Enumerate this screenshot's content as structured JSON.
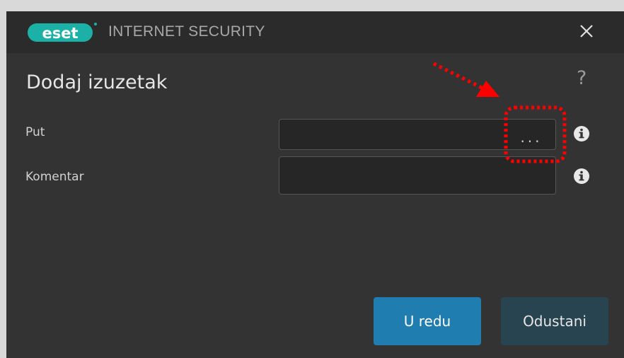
{
  "titlebar": {
    "logo_text": "eset",
    "product_name": "INTERNET SECURITY",
    "close_label": "×"
  },
  "dialog": {
    "title": "Dodaj izuzetak",
    "help_label": "?"
  },
  "form": {
    "path_label": "Put",
    "path_value": "",
    "browse_label": "...",
    "comment_label": "Komentar",
    "comment_value": ""
  },
  "buttons": {
    "ok_label": "U redu",
    "cancel_label": "Odustani"
  },
  "colors": {
    "window_bg": "#333333",
    "titlebar_bg": "#2b2b2b",
    "ok_button": "#1f7db0",
    "cancel_button": "#294451",
    "eset_teal": "#1cb1a7",
    "annotation_red": "#ff0000"
  },
  "icons": {
    "close": "close-icon",
    "help": "help-icon",
    "info": "info-icon",
    "annotation_arrow": "arrow-icon"
  }
}
